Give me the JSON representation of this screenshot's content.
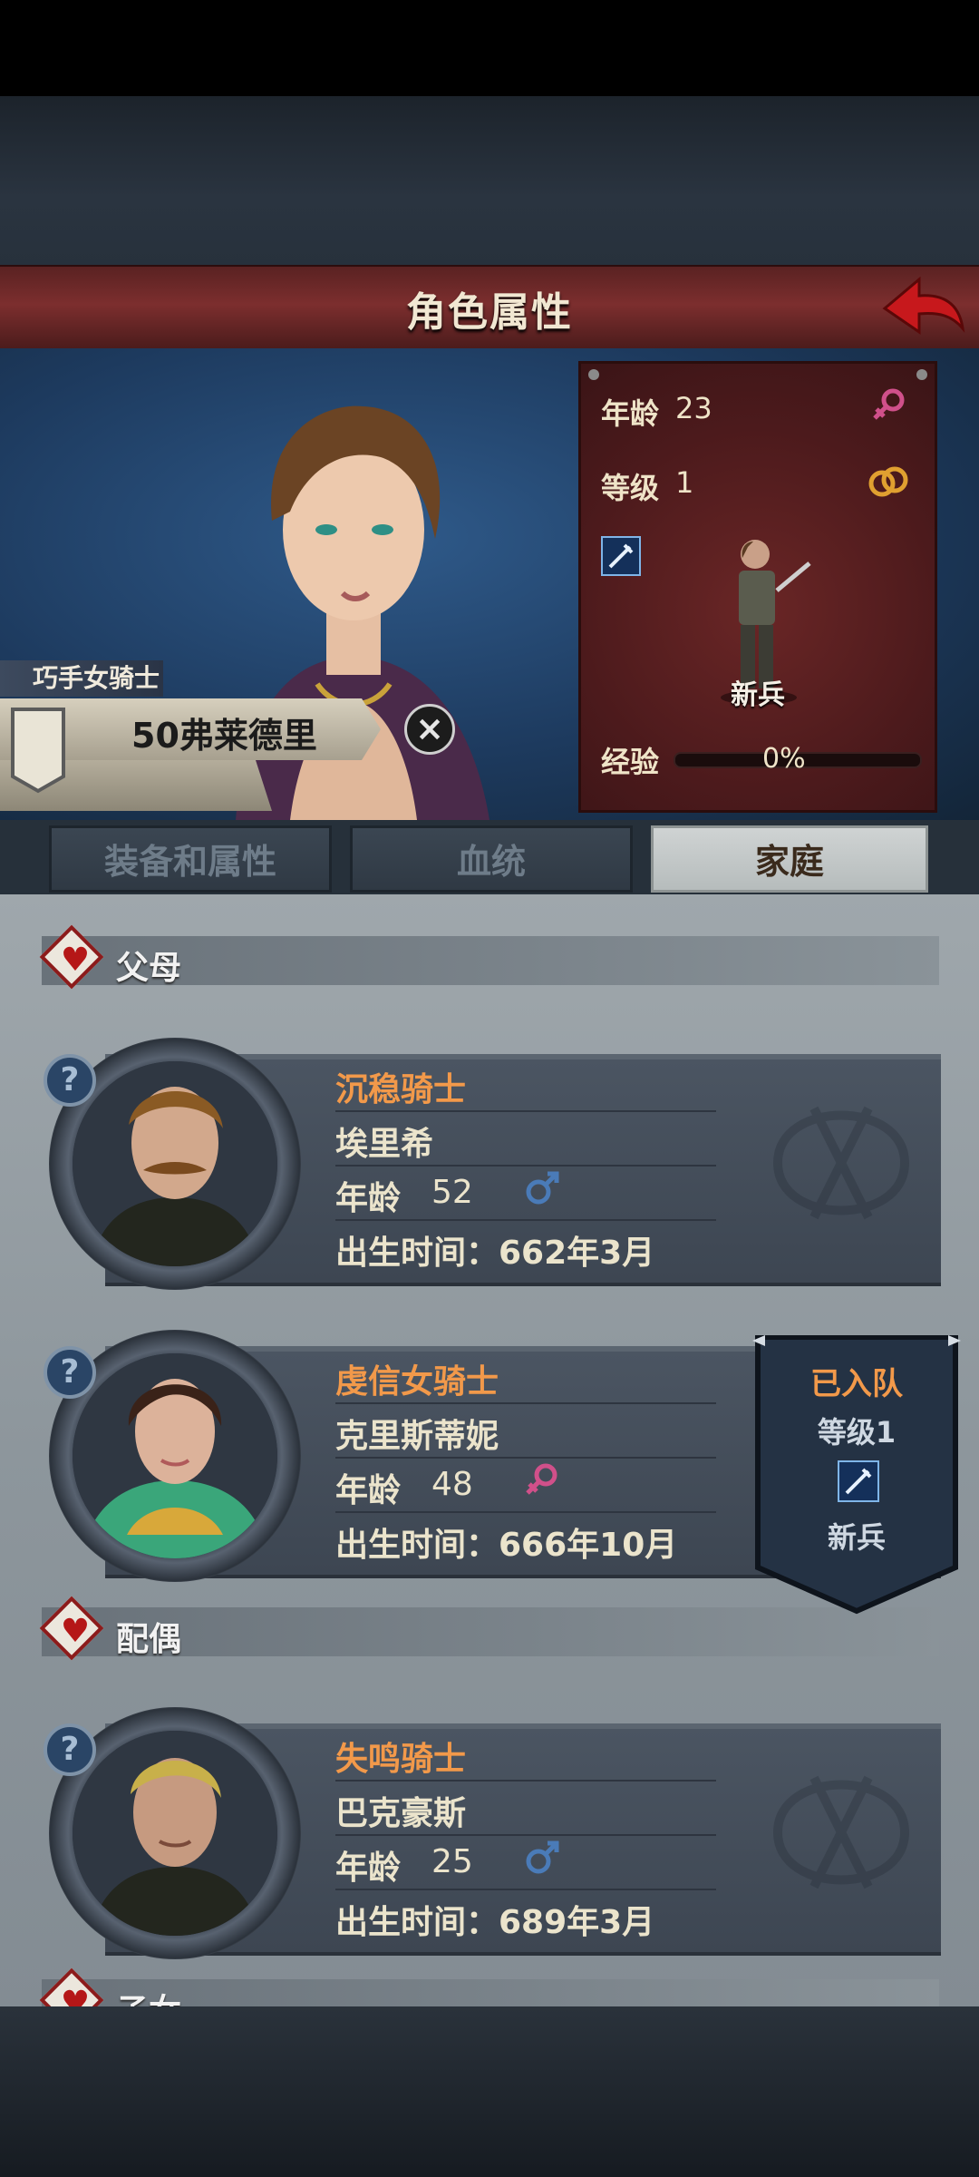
{
  "header": {
    "title": "角色属性"
  },
  "character": {
    "class_title": "巧手女骑士",
    "name": "50弗莱德里",
    "stats": {
      "age_label": "年龄",
      "age_value": "23",
      "level_label": "等级",
      "level_value": "1",
      "exp_label": "经验",
      "exp_percent": "0%",
      "exp_fraction": 0.0,
      "role": "新兵",
      "gender_icon": "female-icon",
      "ring_icon": "ring-icon"
    }
  },
  "tabs": [
    {
      "label": "装备和属性",
      "active": false
    },
    {
      "label": "血统",
      "active": false
    },
    {
      "label": "家庭",
      "active": true
    }
  ],
  "family": {
    "parents_title": "父母",
    "spouse_title": "配偶",
    "children_title": "子女",
    "members": [
      {
        "title": "沉稳骑士",
        "name": "埃里希",
        "age_label": "年龄",
        "age": "52",
        "gender": "male",
        "birth": "出生时间：662年3月"
      },
      {
        "title": "虔信女骑士",
        "name": "克里斯蒂妮",
        "age_label": "年龄",
        "age": "48",
        "gender": "female",
        "birth": "出生时间：666年10月"
      },
      {
        "title": "失鸣骑士",
        "name": "巴克豪斯",
        "age_label": "年龄",
        "age": "25",
        "gender": "male",
        "birth": "出生时间：689年3月"
      }
    ],
    "party_badge": {
      "status": "已入队",
      "level": "等级1",
      "role": "新兵"
    }
  },
  "colors": {
    "accent_orange": "#f2994a",
    "title_red": "#7c2e2e",
    "male_blue": "#4a7bb8",
    "female_pink": "#d0508a"
  }
}
